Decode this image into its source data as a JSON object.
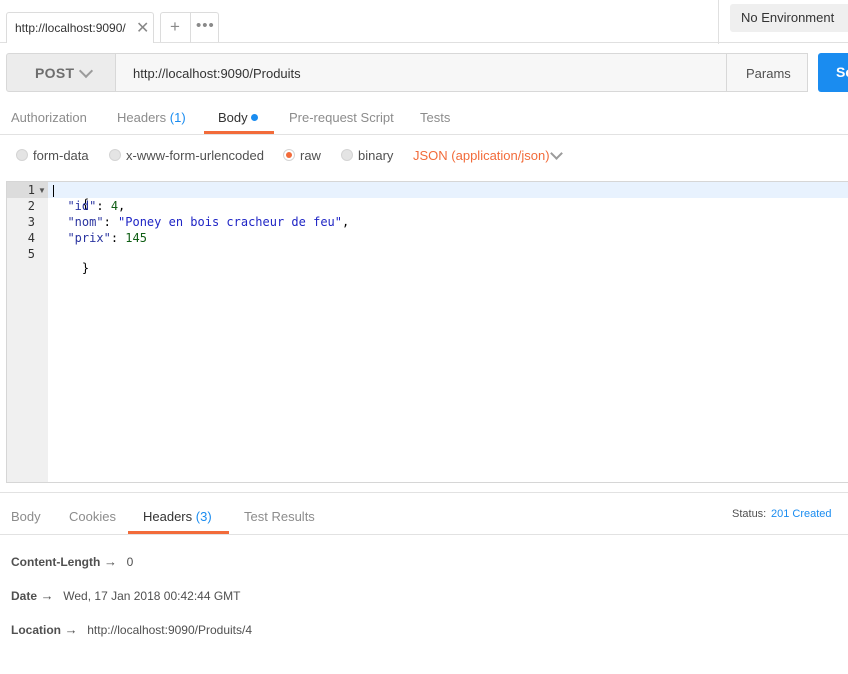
{
  "tabs": {
    "active_tab_label": "http://localhost:9090/",
    "close_symbol": "✕",
    "add_symbol": "+",
    "more_symbol": "•••"
  },
  "environment": {
    "selected": "No Environment"
  },
  "request": {
    "method": "POST",
    "url": "http://localhost:9090/Produits",
    "params_label": "Params",
    "send_label": "Se"
  },
  "request_tabs": [
    {
      "label": "Authorization",
      "count": ""
    },
    {
      "label": "Headers",
      "count": "(1)"
    },
    {
      "label": "Body",
      "count": ""
    },
    {
      "label": "Pre-request Script",
      "count": ""
    },
    {
      "label": "Tests",
      "count": ""
    }
  ],
  "body_modes": {
    "options": [
      "form-data",
      "x-www-form-urlencoded",
      "raw",
      "binary"
    ],
    "selected": "raw",
    "content_type": "JSON (application/json)"
  },
  "editor": {
    "line_numbers": [
      "1",
      "2",
      "3",
      "4",
      "5"
    ],
    "lines": [
      {
        "indent": "",
        "key": "",
        "sep": "",
        "value": "",
        "open": "{"
      },
      {
        "indent": "  ",
        "key": "\"id\"",
        "sep": ": ",
        "value": "4",
        "trail": ","
      },
      {
        "indent": "  ",
        "key": "\"nom\"",
        "sep": ": ",
        "value": "\"Poney en bois cracheur de feu\"",
        "trail": ","
      },
      {
        "indent": "  ",
        "key": "\"prix\"",
        "sep": ": ",
        "value": "145",
        "trail": ""
      },
      {
        "indent": "",
        "key": "",
        "sep": "",
        "value": "",
        "open": "}"
      }
    ]
  },
  "response": {
    "tabs": [
      {
        "label": "Body",
        "count": ""
      },
      {
        "label": "Cookies",
        "count": ""
      },
      {
        "label": "Headers",
        "count": "(3)"
      },
      {
        "label": "Test Results",
        "count": ""
      }
    ],
    "status_label": "Status:",
    "status_value": "201 Created",
    "arrow_symbol": "→",
    "headers": [
      {
        "key": "Content-Length",
        "value": "0"
      },
      {
        "key": "Date",
        "value": "Wed, 17 Jan 2018 00:42:44 GMT"
      },
      {
        "key": "Location",
        "value": "http://localhost:9090/Produits/4"
      }
    ]
  },
  "colors": {
    "accent_orange": "#f26b3a",
    "accent_blue": "#1a8cf0"
  }
}
